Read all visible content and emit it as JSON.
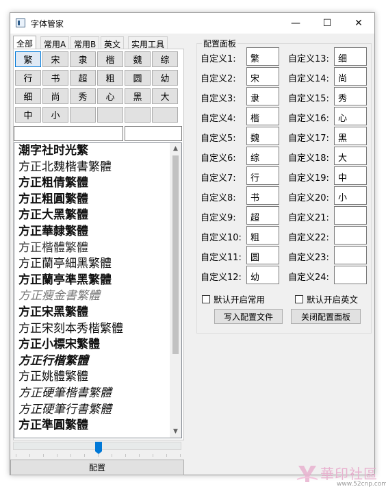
{
  "window": {
    "title": "字体管家",
    "minimize_glyph": "—",
    "maximize_glyph": "☐",
    "close_glyph": "✕"
  },
  "tabs": [
    "全部",
    "常用A",
    "常用B",
    "英文",
    "实用工具"
  ],
  "font_buttons": [
    "繁",
    "宋",
    "隶",
    "楷",
    "魏",
    "综",
    "行",
    "书",
    "超",
    "粗",
    "圆",
    "幼",
    "细",
    "尚",
    "秀",
    "心",
    "黑",
    "大",
    "中",
    "小",
    "",
    "",
    "",
    "",
    "",
    ""
  ],
  "font_list": [
    "潮字社时光繁",
    "方正北魏楷書繁體",
    "方正粗倩繁體",
    "方正粗圓繁體",
    "方正大黑繁體",
    "方正華隸繁體",
    "方正楷體繁體",
    "方正蘭亭細黑繁體",
    "方正蘭亭準黑繁體",
    "方正瘦金書繁體",
    "方正宋黑繁體",
    "方正宋刻本秀楷繁體",
    "方正小標宋繁體",
    "方正行楷繁體",
    "方正姚體繁體",
    "方正硬筆楷書繁體",
    "方正硬筆行書繁體",
    "方正準圓繁體"
  ],
  "config_button": "配置",
  "config_panel": {
    "title": "配置面板",
    "left": [
      {
        "label": "自定义1:",
        "value": "繁"
      },
      {
        "label": "自定义2:",
        "value": "宋"
      },
      {
        "label": "自定义3:",
        "value": "隶"
      },
      {
        "label": "自定义4:",
        "value": "楷"
      },
      {
        "label": "自定义5:",
        "value": "魏"
      },
      {
        "label": "自定义6:",
        "value": "综"
      },
      {
        "label": "自定义7:",
        "value": "行"
      },
      {
        "label": "自定义8:",
        "value": "书"
      },
      {
        "label": "自定义9:",
        "value": "超"
      },
      {
        "label": "自定义10:",
        "value": "粗"
      },
      {
        "label": "自定义11:",
        "value": "圆"
      },
      {
        "label": "自定义12:",
        "value": "幼"
      }
    ],
    "right": [
      {
        "label": "自定义13:",
        "value": "细"
      },
      {
        "label": "自定义14:",
        "value": "尚"
      },
      {
        "label": "自定义15:",
        "value": "秀"
      },
      {
        "label": "自定义16:",
        "value": "心"
      },
      {
        "label": "自定义17:",
        "value": "黑"
      },
      {
        "label": "自定义18:",
        "value": "大"
      },
      {
        "label": "自定义19:",
        "value": "中"
      },
      {
        "label": "自定义20:",
        "value": "小"
      },
      {
        "label": "自定义21:",
        "value": ""
      },
      {
        "label": "自定义22:",
        "value": ""
      },
      {
        "label": "自定义23:",
        "value": ""
      },
      {
        "label": "自定义24:",
        "value": ""
      }
    ],
    "default_common_label": "默认开启常用",
    "default_english_label": "默认开启英文",
    "write_config_label": "写入配置文件",
    "close_panel_label": "关闭配置面板"
  },
  "watermark": {
    "text": "華印社區",
    "url": "www.52cnp.com"
  },
  "colors": {
    "accent": "#0078d7",
    "selected_bg": "#dfe9f5",
    "watermark": "#e8b1cf"
  }
}
